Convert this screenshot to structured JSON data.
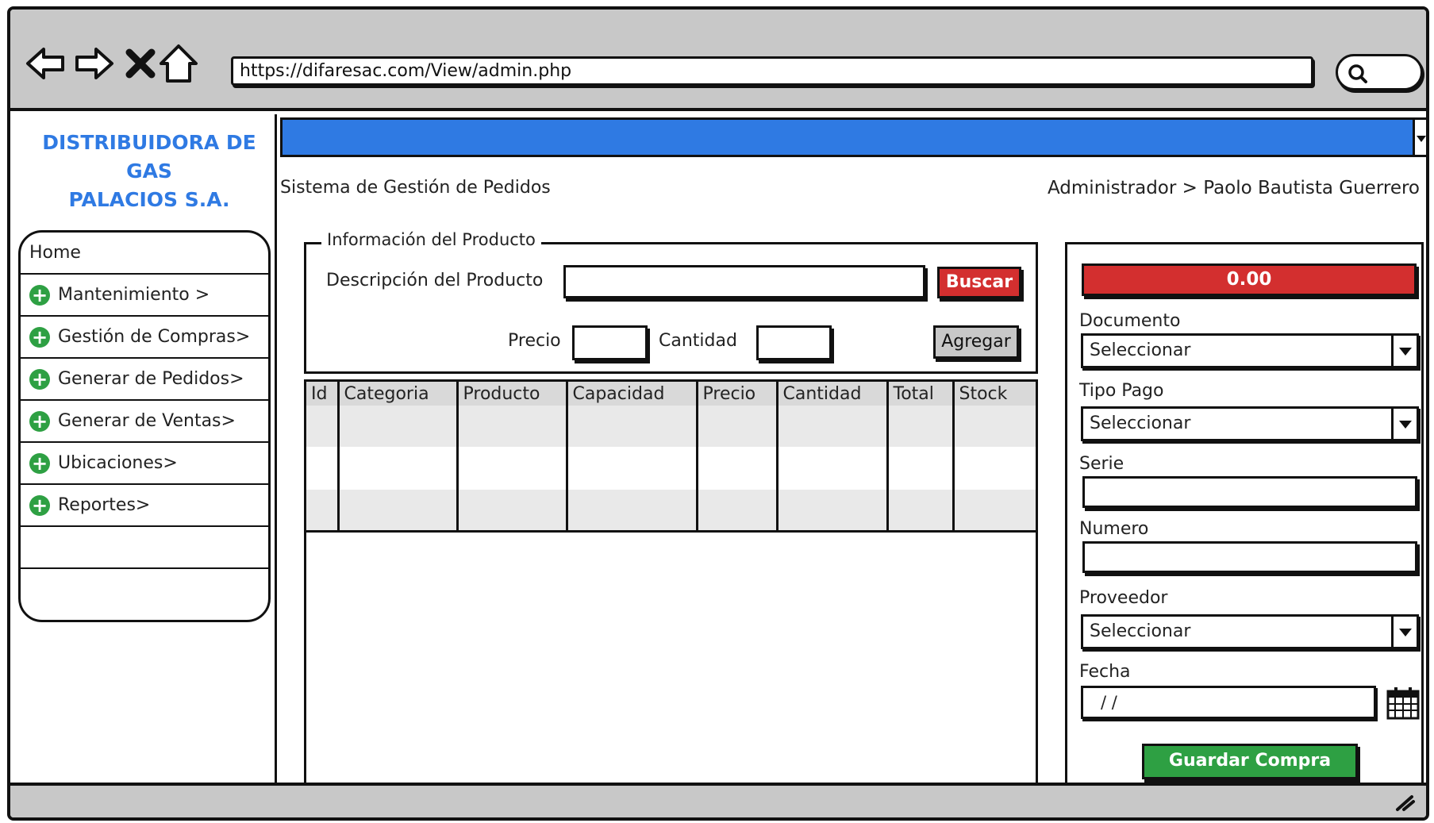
{
  "browser": {
    "url": "https://difaresac.com/View/admin.php"
  },
  "brand": {
    "line1": "DISTRIBUIDORA DE GAS",
    "line2": "PALACIOS S.A."
  },
  "sidebar": {
    "items": [
      {
        "label": "Home"
      },
      {
        "label": "Mantenimiento >"
      },
      {
        "label": "Gestión de Compras>"
      },
      {
        "label": "Generar de Pedidos>"
      },
      {
        "label": "Generar de Ventas>"
      },
      {
        "label": "Ubicaciones>"
      },
      {
        "label": "Reportes>"
      }
    ]
  },
  "header": {
    "system_title": "Sistema de Gestión de Pedidos",
    "user_path": "Administrador > Paolo Bautista Guerrero"
  },
  "product_form": {
    "legend": "Información del Producto",
    "description_label": "Descripción del Producto",
    "description_value": "",
    "search_button": "Buscar",
    "price_label": "Precio",
    "price_value": "",
    "quantity_label": "Cantidad",
    "quantity_value": "",
    "add_button": "Agregar"
  },
  "table": {
    "columns": [
      "Id",
      "Categoria",
      "Producto",
      "Capacidad",
      "Precio",
      "Cantidad",
      "Total",
      "Stock"
    ]
  },
  "order_panel": {
    "total": "0.00",
    "document_label": "Documento",
    "document_value": "Seleccionar",
    "payment_label": "Tipo Pago",
    "payment_value": "Seleccionar",
    "serie_label": "Serie",
    "serie_value": "",
    "numero_label": "Numero",
    "numero_value": "",
    "supplier_label": "Proveedor",
    "supplier_value": "Seleccionar",
    "date_label": "Fecha",
    "date_value": "/  /",
    "save_button": "Guardar Compra"
  },
  "colors": {
    "accent_blue": "#2f7ae3",
    "danger_red": "#d32f2f",
    "success_green": "#2ea043",
    "chrome_gray": "#c8c8c8"
  },
  "icons": [
    "back-arrow-icon",
    "forward-arrow-icon",
    "close-icon",
    "home-icon",
    "search-icon",
    "plus-circle-icon",
    "calendar-icon",
    "resize-grip-icon"
  ]
}
